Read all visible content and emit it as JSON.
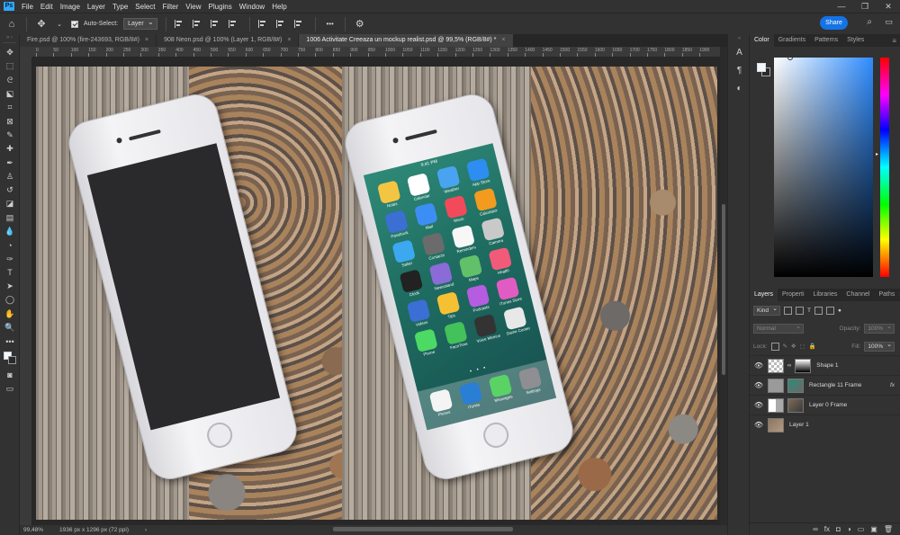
{
  "menubar": {
    "logo": "Ps",
    "items": [
      "File",
      "Edit",
      "Image",
      "Layer",
      "Type",
      "Select",
      "Filter",
      "View",
      "Plugins",
      "Window",
      "Help"
    ]
  },
  "options": {
    "auto_select_label": "Auto-Select:",
    "auto_select_value": "Layer",
    "more": "•••",
    "share": "Share"
  },
  "tabs": [
    {
      "label": "Fire.psd @ 100% (fire-243693, RGB/8#)",
      "close": "×"
    },
    {
      "label": "908 Neon.psd @ 100% (Layer 1, RGB/8#)",
      "close": "×"
    },
    {
      "label": "1006 Activitate Creeaza un mockup realist.psd @ 99,5% (RGB/8#) *",
      "close": "×"
    }
  ],
  "ruler_ticks": [
    "0",
    "50",
    "100",
    "150",
    "200",
    "250",
    "300",
    "350",
    "400",
    "450",
    "500",
    "550",
    "600",
    "650",
    "700",
    "750",
    "800",
    "850",
    "900",
    "950",
    "1000",
    "1050",
    "1100",
    "1150",
    "1200",
    "1250",
    "1300",
    "1350",
    "1400",
    "1450",
    "1500",
    "1550",
    "1600",
    "1650",
    "1700",
    "1750",
    "1800",
    "1850",
    "1900"
  ],
  "phone_screen": {
    "time": "9:41 PM",
    "apps": [
      {
        "label": "Notes",
        "color": "#f4c542"
      },
      {
        "label": "Calendar",
        "color": "#ffffff"
      },
      {
        "label": "Weather",
        "color": "#4aa3f0"
      },
      {
        "label": "App Store",
        "color": "#2e8df0"
      },
      {
        "label": "Passbook",
        "color": "#3b6fd4"
      },
      {
        "label": "Mail",
        "color": "#3d8ef4"
      },
      {
        "label": "Music",
        "color": "#f24a5a"
      },
      {
        "label": "Calculator",
        "color": "#f29b1e"
      },
      {
        "label": "Safari",
        "color": "#3ba8f0"
      },
      {
        "label": "Contacts",
        "color": "#6b6b6b"
      },
      {
        "label": "Reminders",
        "color": "#f7f7f7"
      },
      {
        "label": "Camera",
        "color": "#c9c9c9"
      },
      {
        "label": "Clock",
        "color": "#222222"
      },
      {
        "label": "Newsstand",
        "color": "#8a6bd8"
      },
      {
        "label": "Maps",
        "color": "#63c06a"
      },
      {
        "label": "Health",
        "color": "#f25a7a"
      },
      {
        "label": "Videos",
        "color": "#3b6fd4"
      },
      {
        "label": "Tips",
        "color": "#f6c034"
      },
      {
        "label": "Podcasts",
        "color": "#b55ce0"
      },
      {
        "label": "iTunes Store",
        "color": "#e05cc2"
      },
      {
        "label": "Phone",
        "color": "#4cd964"
      },
      {
        "label": "FaceTime",
        "color": "#43c15a"
      },
      {
        "label": "Voice Memos",
        "color": "#333333"
      },
      {
        "label": "Game Center",
        "color": "#e8e8e8"
      }
    ],
    "dock": [
      {
        "label": "Photos",
        "color": "#f4f4f4"
      },
      {
        "label": "iTunes",
        "color": "#2a7fd4"
      },
      {
        "label": "Messages",
        "color": "#5ad364"
      },
      {
        "label": "Settings",
        "color": "#8e8e93"
      }
    ],
    "page_dots": "• • •"
  },
  "status": {
    "zoom": "99,48%",
    "doc_size": "1936 px x 1296 px (72 ppi)",
    "nav_arrow": "›"
  },
  "strip": {
    "icons": [
      "A",
      "¶",
      "◐"
    ]
  },
  "color_panel": {
    "tabs": [
      "Color",
      "Gradients",
      "Patterns",
      "Styles"
    ],
    "active": "Color",
    "fg_color": "#f2f7fb",
    "bg_color": "#2a2a2a"
  },
  "layers_panel": {
    "tabs": [
      "Layers",
      "Properti",
      "Libraries",
      "Channel",
      "Paths"
    ],
    "active": "Layers",
    "filter": "Kind",
    "blend_mode": "Normal",
    "opacity_label": "Opacity:",
    "opacity_value": "100%",
    "lock_label": "Lock:",
    "fill_label": "Fill:",
    "fill_value": "100%",
    "layers": [
      {
        "name": "Shape 1",
        "fx": ""
      },
      {
        "name": "Rectangle 11 Frame",
        "fx": "fx"
      },
      {
        "name": "Layer 0 Frame",
        "fx": ""
      },
      {
        "name": "Layer 1",
        "fx": ""
      }
    ],
    "bottom_icons": [
      "∞",
      "fx",
      "◘",
      "◑",
      "▭",
      "▣",
      "🗑"
    ]
  }
}
